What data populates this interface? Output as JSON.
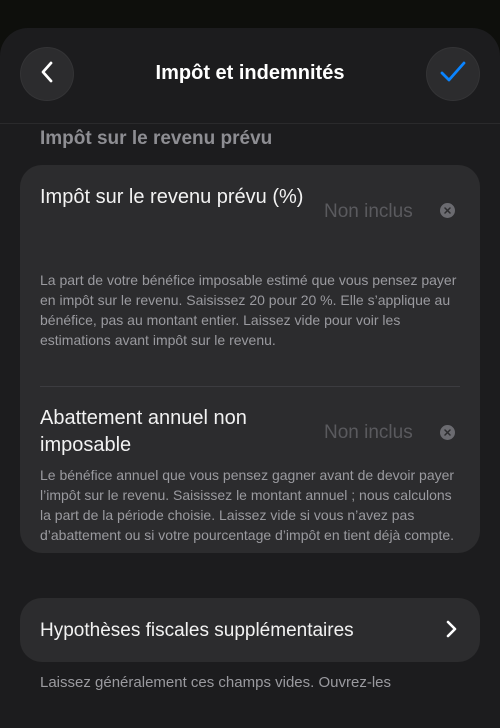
{
  "header": {
    "title": "Impôt et indemnités",
    "back_icon": "chevron-left-icon",
    "confirm_icon": "checkmark-icon",
    "accent_color": "#0a84ff"
  },
  "section": {
    "title": "Impôt sur le revenu prévu"
  },
  "fields": [
    {
      "label": "Impôt sur le revenu prévu (%)",
      "value_placeholder": "Non inclus",
      "help": "La part de votre bénéfice imposable estimé que vous pensez payer en impôt sur le revenu. Saisissez 20 pour 20 %. Elle s’applique au bénéfice, pas au montant entier. Laissez vide pour voir les estimations avant impôt sur le revenu."
    },
    {
      "label": "Abattement annuel non imposable",
      "value_placeholder": "Non inclus",
      "help": "Le bénéfice annuel que vous pensez gagner avant de devoir payer l’impôt sur le revenu. Saisissez le montant annuel ; nous calculons la part de la période choisie. Laissez vide si vous n’avez pas d’abattement ou si votre pourcentage d’impôt en tient déjà compte."
    }
  ],
  "additional": {
    "label": "Hypothèses fiscales supplémentaires",
    "footer": "Laissez généralement ces champs vides. Ouvrez-les"
  }
}
